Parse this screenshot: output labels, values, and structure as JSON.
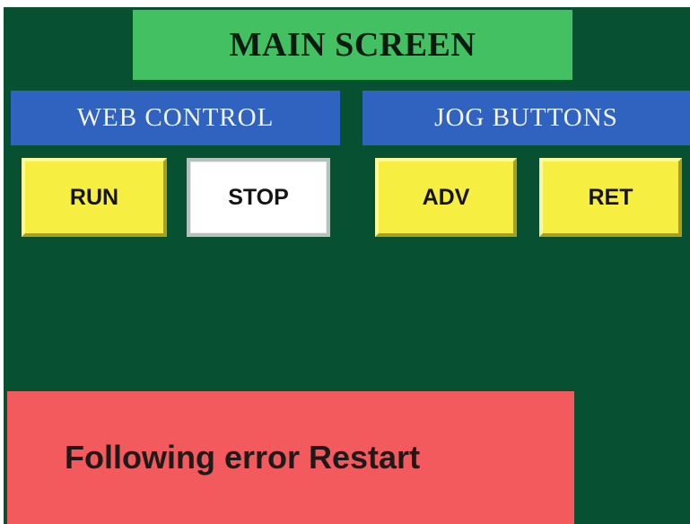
{
  "header": {
    "title": "MAIN SCREEN"
  },
  "web_control": {
    "label": "WEB CONTROL",
    "run_label": "RUN",
    "stop_label": "STOP"
  },
  "jog_buttons": {
    "label": "JOG BUTTONS",
    "adv_label": "ADV",
    "ret_label": "RET"
  },
  "status": {
    "message": "Following error Restart"
  },
  "colors": {
    "background": "#075031",
    "title_banner": "#43c062",
    "section_header": "#2f63bf",
    "button_yellow": "#f6ee40",
    "button_active": "#ffffff",
    "error_panel": "#f25a5d"
  }
}
